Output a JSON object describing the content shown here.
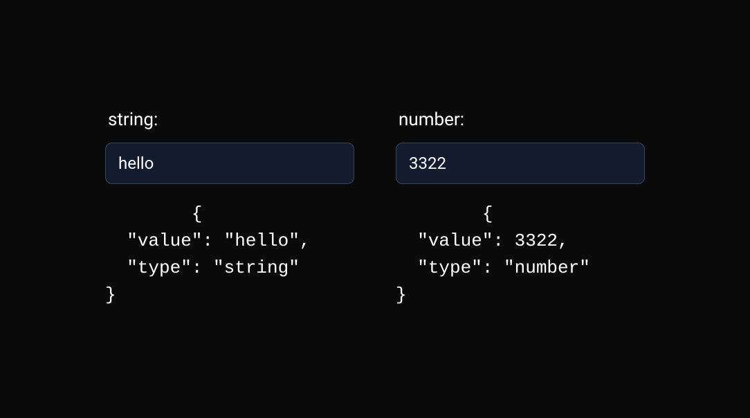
{
  "left": {
    "label": "string:",
    "value": "hello",
    "output": "        {\n  \"value\": \"hello\",\n  \"type\": \"string\"\n}"
  },
  "right": {
    "label": "number:",
    "value": "3322",
    "output": "        {\n  \"value\": 3322,\n  \"type\": \"number\"\n}"
  }
}
